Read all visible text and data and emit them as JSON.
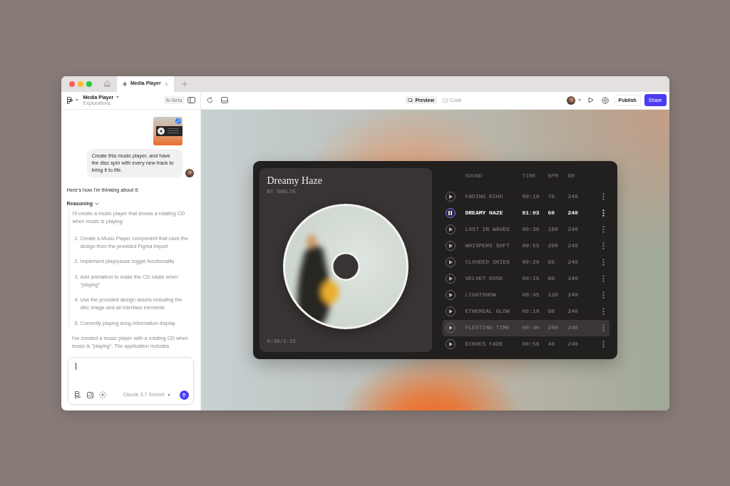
{
  "browser": {
    "tabs": [
      {
        "kind": "home",
        "selected": false
      },
      {
        "kind": "page",
        "label": "Media Player",
        "selected": true
      }
    ]
  },
  "toolbar": {
    "project_title": "Media Player",
    "project_subtitle": "Explorations",
    "badge": "AI Beta",
    "view_tabs": [
      {
        "kind": "preview",
        "label": "Preview",
        "selected": true
      },
      {
        "kind": "code",
        "label": "Code",
        "selected": false
      }
    ],
    "buttons": [
      {
        "kind": "publish",
        "label": "Publish"
      },
      {
        "kind": "share",
        "label": "Share"
      }
    ]
  },
  "chat": {
    "user_message": {
      "attachments": [
        {
          "kind": "image"
        }
      ],
      "text": "Create this music player, and have the disc spin with every new track to bring it to life."
    },
    "intro": "Here's how I'm thinking about it:",
    "reasoning": {
      "label": "Reasoning",
      "expanded": true,
      "text": "I'll create a music player that shows a rotating CD when music is playing:",
      "steps": [
        {
          "number": "1.",
          "text": "Create a Music Player component that uses the design from the provided Figma import"
        },
        {
          "number": "2.",
          "text": "Implement play/pause toggle functionality"
        },
        {
          "number": "3.",
          "text": "Add animation to make the CD rotate when \"playing\""
        },
        {
          "number": "4.",
          "text": "Use the provided design assets including the disc image and all interface elements"
        },
        {
          "number": "5.",
          "text": "Currently playing song information display"
        }
      ]
    },
    "summary": "I've created a music player with a rotating CD when music is \"playing\". The application includes",
    "composer": {
      "model": "Claude 3.7 Sonnet"
    }
  },
  "player": {
    "title": "Dreamy Haze",
    "artist": "BY SVELTE",
    "progress": "0:30/2:22",
    "columns": [
      "SOUND",
      "TIME",
      "BPM",
      "BR"
    ],
    "tracks": [
      {
        "sound": "FADING ECHO",
        "time": "00:10",
        "bpm": "70",
        "br": "240",
        "playing": false,
        "highlighted": false
      },
      {
        "sound": "DREAMY HAZE",
        "time": "01:03",
        "bpm": "60",
        "br": "240",
        "playing": true,
        "highlighted": false
      },
      {
        "sound": "LOST IN WAVES",
        "time": "00:30",
        "bpm": "180",
        "br": "240",
        "playing": false,
        "highlighted": false
      },
      {
        "sound": "WHISPERS SOFT",
        "time": "00:55",
        "bpm": "200",
        "br": "240",
        "playing": false,
        "highlighted": false
      },
      {
        "sound": "CLOUDED SKIES",
        "time": "00:20",
        "bpm": "80",
        "br": "240",
        "playing": false,
        "highlighted": false
      },
      {
        "sound": "VELVET DUSK",
        "time": "00:15",
        "bpm": "90",
        "br": "240",
        "playing": false,
        "highlighted": false
      },
      {
        "sound": "LIGHTSHOW",
        "time": "00:45",
        "bpm": "120",
        "br": "240",
        "playing": false,
        "highlighted": false
      },
      {
        "sound": "ETHEREAL GLOW",
        "time": "05:10",
        "bpm": "80",
        "br": "240",
        "playing": false,
        "highlighted": false
      },
      {
        "sound": "FLEETING TIME",
        "time": "00:40",
        "bpm": "200",
        "br": "240",
        "playing": false,
        "highlighted": true
      },
      {
        "sound": "ECHOES FADE",
        "time": "00:56",
        "bpm": "40",
        "br": "240",
        "playing": false,
        "highlighted": false
      }
    ]
  }
}
